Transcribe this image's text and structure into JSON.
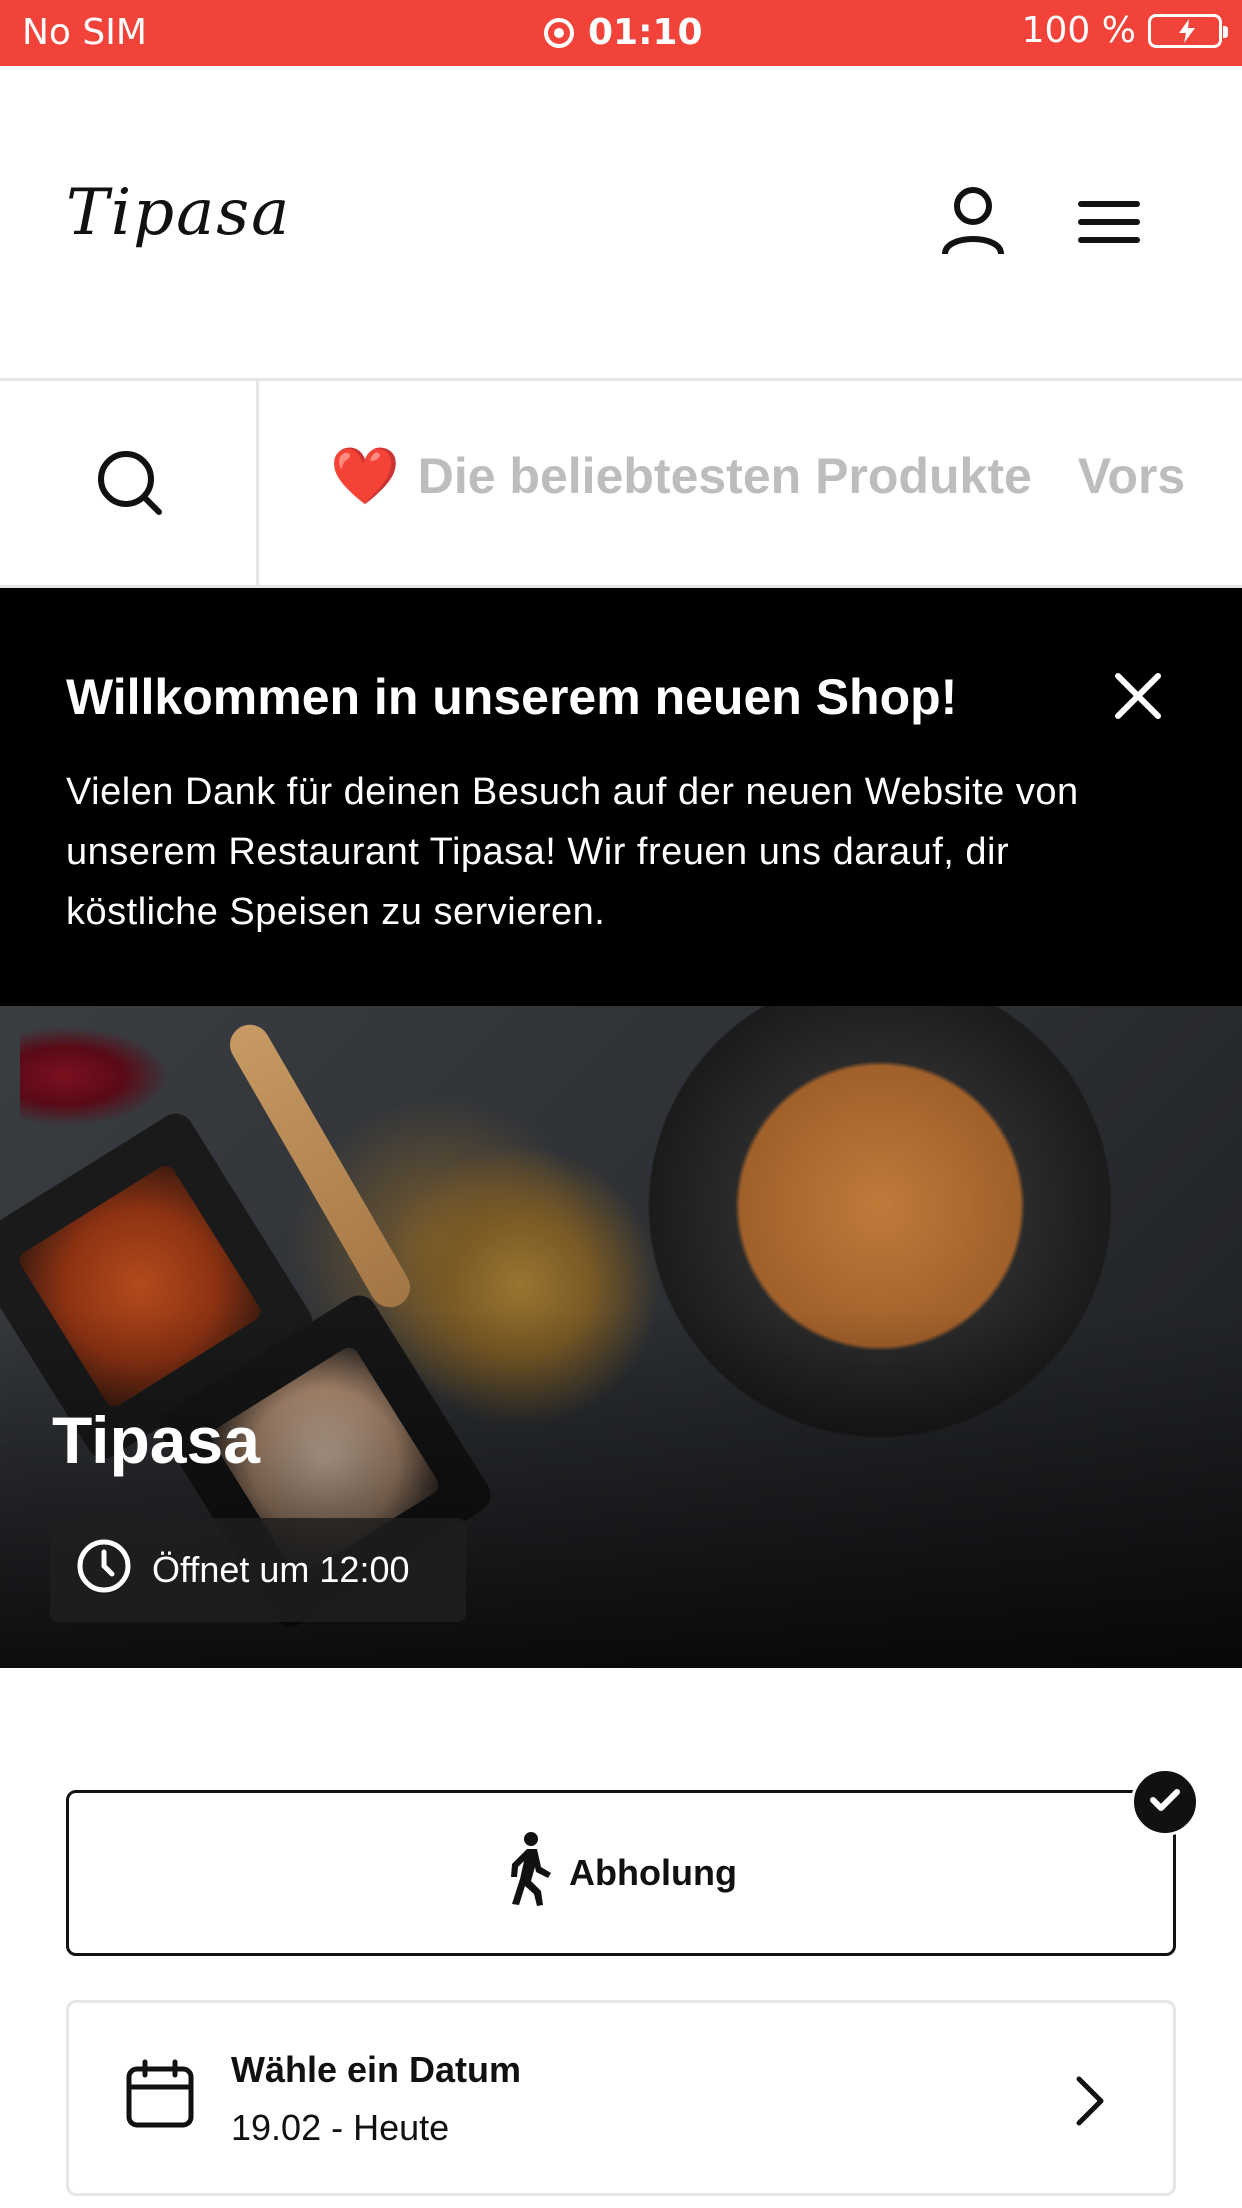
{
  "status_bar": {
    "carrier": "No SIM",
    "time": "01:10",
    "battery": "100 %",
    "color": "#f2433b"
  },
  "header": {
    "logo": "Tipasa",
    "icons": [
      "user-icon",
      "menu-icon"
    ]
  },
  "category_nav": {
    "icons": [
      "search-icon"
    ],
    "items": [
      {
        "emoji": "❤️",
        "label": "Die beliebtesten Produkte"
      },
      {
        "label": "Vors"
      }
    ]
  },
  "welcome_banner": {
    "title": "Willkommen in unserem neuen Shop!",
    "text": "Vielen Dank für deinen Besuch auf der neuen Website von unserem Restaurant Tipasa! Wir freuen uns darauf, dir köstliche Speisen zu servieren.",
    "icons": [
      "close-icon"
    ]
  },
  "hero": {
    "title": "Tipasa",
    "hours": "Öffnet um 12:00",
    "icons": [
      "clock-icon"
    ]
  },
  "order_type": {
    "label": "Abholung",
    "selected": true,
    "icons": [
      "walking-person-icon",
      "check-icon"
    ]
  },
  "date_picker": {
    "title": "Wähle ein Datum",
    "value": "19.02 - Heute",
    "icons": [
      "calendar-icon",
      "chevron-right-icon"
    ]
  }
}
